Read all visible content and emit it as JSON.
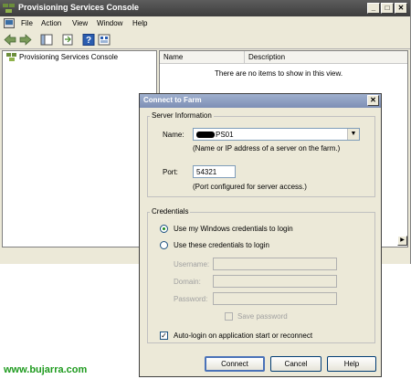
{
  "window": {
    "title": "Provisioning Services Console",
    "caption_min": "_",
    "caption_max": "□",
    "caption_close": "✕"
  },
  "menu": [
    "File",
    "Action",
    "View",
    "Window",
    "Help"
  ],
  "tree": {
    "root_label": "Provisioning Services Console"
  },
  "list": {
    "columns": [
      "Name",
      "Description"
    ],
    "empty_message": "There are no items to show in this view."
  },
  "dialog": {
    "title": "Connect to Farm",
    "close_glyph": "✕",
    "server_group": "Server Information",
    "name_label": "Name:",
    "name_value": "PS01",
    "name_hint": "(Name or IP address of a server on the farm.)",
    "port_label": "Port:",
    "port_value": "54321",
    "port_hint": "(Port configured for server access.)",
    "credentials_group": "Credentials",
    "radio_windows": "Use my Windows credentials to login",
    "radio_these": "Use these credentials to login",
    "username_label": "Username:",
    "domain_label": "Domain:",
    "password_label": "Password:",
    "save_password": "Save password",
    "autologin": "Auto-login on application start or reconnect",
    "connect": "Connect",
    "cancel": "Cancel",
    "help": "Help"
  },
  "watermark": "www.bujarra.com",
  "colors": {
    "title_bar": "#4a4a4a",
    "dialog_title": "#8b9cc0",
    "window_bg": "#ece9d8",
    "watermark": "#1e9a1e"
  }
}
